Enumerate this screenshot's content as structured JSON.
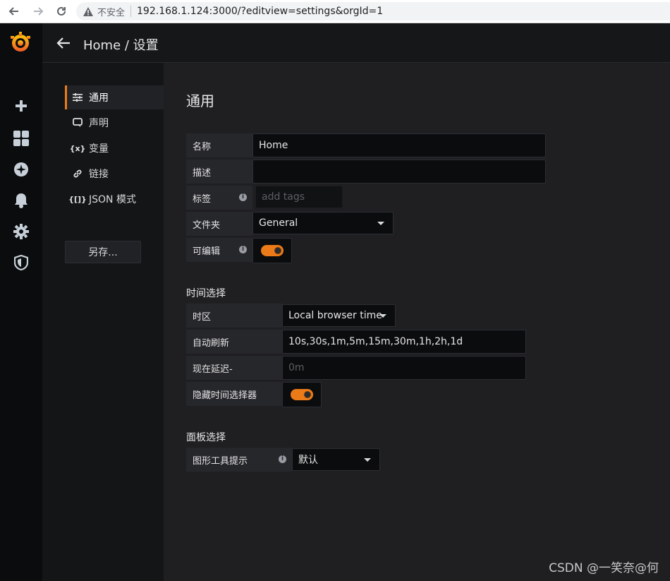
{
  "browser": {
    "insecure_label": "不安全",
    "url": "192.168.1.124:3000/?editview=settings&orgId=1"
  },
  "topbar": {
    "breadcrumb": "Home / 设置"
  },
  "settings_nav": {
    "items": [
      {
        "label": "通用",
        "icon": "sliders-icon"
      },
      {
        "label": "声明",
        "icon": "comment-icon"
      },
      {
        "label": "变量",
        "icon": "variable-icon"
      },
      {
        "label": "链接",
        "icon": "link-icon"
      },
      {
        "label": "JSON 模式",
        "icon": "json-icon"
      }
    ],
    "save_as": "另存..."
  },
  "general": {
    "title": "通用",
    "name_label": "名称",
    "name_value": "Home",
    "desc_label": "描述",
    "desc_value": "",
    "tags_label": "标签",
    "tags_placeholder": "add tags",
    "folder_label": "文件夹",
    "folder_value": "General",
    "editable_label": "可编辑"
  },
  "time": {
    "title": "时间选择",
    "timezone_label": "时区",
    "timezone_value": "Local browser time",
    "refresh_label": "自动刷新",
    "refresh_value": "10s,30s,1m,5m,15m,30m,1h,2h,1d",
    "delay_label": "现在延迟-",
    "delay_placeholder": "0m",
    "hide_picker_label": "隐藏时间选择器"
  },
  "panel": {
    "title": "面板选择",
    "tooltip_label": "图形工具提示",
    "tooltip_value": "默认"
  },
  "watermark": "CSDN @一笑奈@何",
  "colors": {
    "accent": "#eb7b18",
    "background": "#1f1f22"
  }
}
